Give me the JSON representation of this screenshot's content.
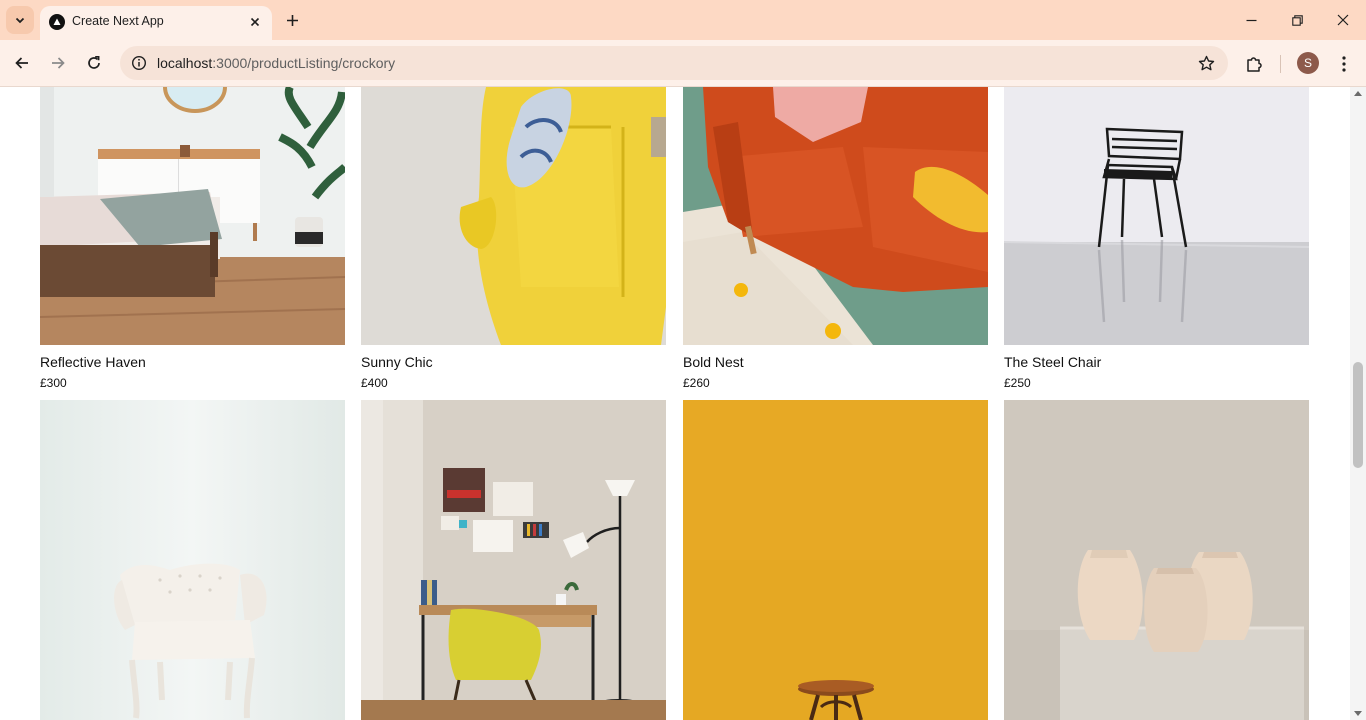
{
  "browser": {
    "tab_title": "Create Next App",
    "url_host": "localhost",
    "url_path": ":3000/productListing/crockory",
    "profile_initial": "S",
    "icons": {
      "tab_search": "chevron-down-icon",
      "favicon": "nextjs-triangle-icon",
      "tab_close": "close-icon",
      "new_tab": "plus-icon",
      "back": "arrow-left-icon",
      "forward": "arrow-right-icon",
      "reload": "reload-icon",
      "site_info": "info-icon",
      "bookmark": "star-icon",
      "extensions": "puzzle-icon",
      "menu": "kebab-menu-icon",
      "minimize": "minimize-icon",
      "restore": "restore-icon",
      "close_window": "close-icon"
    },
    "colors": {
      "frame": "#fdd9c4",
      "toolbar": "#fdf0e9",
      "omnibox": "#f6e3d8"
    }
  },
  "products": [
    {
      "name": "Reflective Haven",
      "price": "£300"
    },
    {
      "name": "Sunny Chic",
      "price": "£400"
    },
    {
      "name": "Bold Nest",
      "price": "£260"
    },
    {
      "name": "The Steel Chair",
      "price": "£250"
    },
    {
      "name": "",
      "price": ""
    },
    {
      "name": "",
      "price": ""
    },
    {
      "name": "",
      "price": ""
    },
    {
      "name": "",
      "price": ""
    }
  ]
}
